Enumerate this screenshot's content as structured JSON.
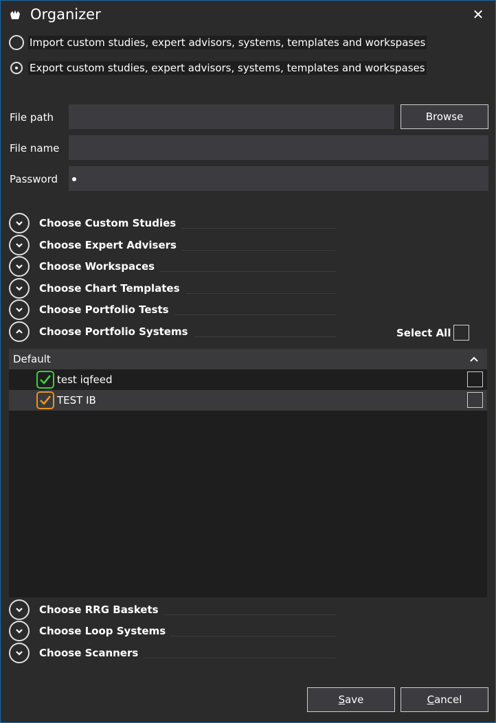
{
  "window": {
    "title": "Organizer",
    "close_glyph": "✕",
    "app_icon": "organizer-app-icon"
  },
  "mode": {
    "import_label": "Import custom studies, expert advisors, systems, templates and workspases",
    "export_label": "Export custom studies, expert advisors, systems, templates and workspases",
    "selected": "export"
  },
  "fields": {
    "file_path_label": "File path",
    "file_path_value": "",
    "browse_label": "Browse",
    "file_name_label": "File name",
    "file_name_value": "",
    "password_label": "Password"
  },
  "sections": [
    {
      "label": "Choose Custom Studies",
      "expanded": false
    },
    {
      "label": "Choose Expert Advisers",
      "expanded": false
    },
    {
      "label": "Choose Workspaces",
      "expanded": false
    },
    {
      "label": "Choose Chart Templates",
      "expanded": false
    },
    {
      "label": "Choose Portfolio Tests",
      "expanded": false
    },
    {
      "label": "Choose Portfolio Systems",
      "expanded": true
    },
    {
      "label": "Choose RRG Baskets",
      "expanded": false
    },
    {
      "label": "Choose Loop Systems",
      "expanded": false
    },
    {
      "label": "Choose Scanners",
      "expanded": false
    }
  ],
  "portfolio_systems": {
    "select_all_label": "Select All",
    "group_label": "Default",
    "items": [
      {
        "name": "test iqfeed",
        "status_color": "#3ad23a",
        "checked": false
      },
      {
        "name": "TEST IB",
        "status_color": "#e8941c",
        "checked": false
      }
    ]
  },
  "footer": {
    "save_mnemonic": "S",
    "save_rest": "ave",
    "cancel_mnemonic": "C",
    "cancel_rest": "ancel"
  },
  "colors": {
    "background": "#2b2b2b",
    "border": "#1a6aa8",
    "input": "#3c3c40"
  }
}
